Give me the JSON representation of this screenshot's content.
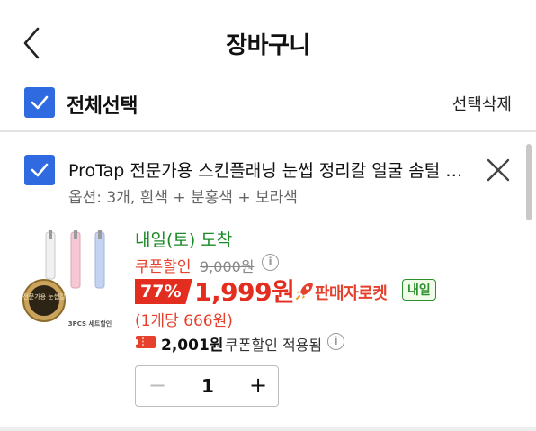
{
  "header": {
    "title": "장바구니",
    "back_icon": "chevron-left-icon"
  },
  "select_bar": {
    "select_all_label": "전체선택",
    "delete_selected_label": "선택삭제",
    "checked": true
  },
  "item": {
    "checked": true,
    "title": "ProTap 전문가용 스킨플래닝 눈썹 정리칼 얼굴 솜털 면도기",
    "options": "옵션: 3개, 흰색 + 분홍색 + 보라색",
    "thumbnail": {
      "badge_text": "전문가용 눈썹칼",
      "caption": "3PCS 세트할인"
    },
    "arrival": "내일(토) 도착",
    "coupon_label": "쿠폰할인",
    "original_price": "9,000원",
    "discount_rate": "77%",
    "price": "1,999원",
    "rocket_label": "판매자로켓",
    "tomorrow_badge": "내일",
    "unit_price": "(1개당 666원)",
    "coupon_applied_amount": "2,001원",
    "coupon_applied_text": "쿠폰할인 적용됨",
    "quantity": "1",
    "qty_minus": "−",
    "qty_plus": "+"
  },
  "colors": {
    "accent": "#2f6ae0",
    "price_red": "#e32d1f",
    "green": "#1a8b28"
  }
}
